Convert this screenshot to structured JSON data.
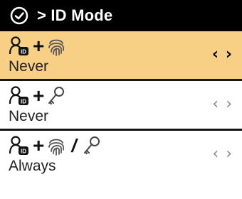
{
  "header": {
    "title": "> ID Mode",
    "logo_icon": "shield-check-icon"
  },
  "rows": [
    {
      "icons": [
        "id-user-icon",
        "plus",
        "fingerprint-icon"
      ],
      "value": "Never",
      "selected": true,
      "arrow_left": "‹",
      "arrow_right": "›"
    },
    {
      "icons": [
        "id-user-icon",
        "plus",
        "key-icon"
      ],
      "value": "Never",
      "selected": false,
      "arrow_left": "‹",
      "arrow_right": "›"
    },
    {
      "icons": [
        "id-user-icon",
        "plus",
        "fingerprint-icon",
        "slash",
        "key-icon"
      ],
      "value": "Always",
      "selected": false,
      "arrow_left": "‹",
      "arrow_right": "›"
    }
  ],
  "colors": {
    "header_bg": "#000000",
    "selected_bg": "#f7cf85",
    "divider": "#151515"
  },
  "symbols": {
    "plus": "+",
    "slash": "/"
  }
}
